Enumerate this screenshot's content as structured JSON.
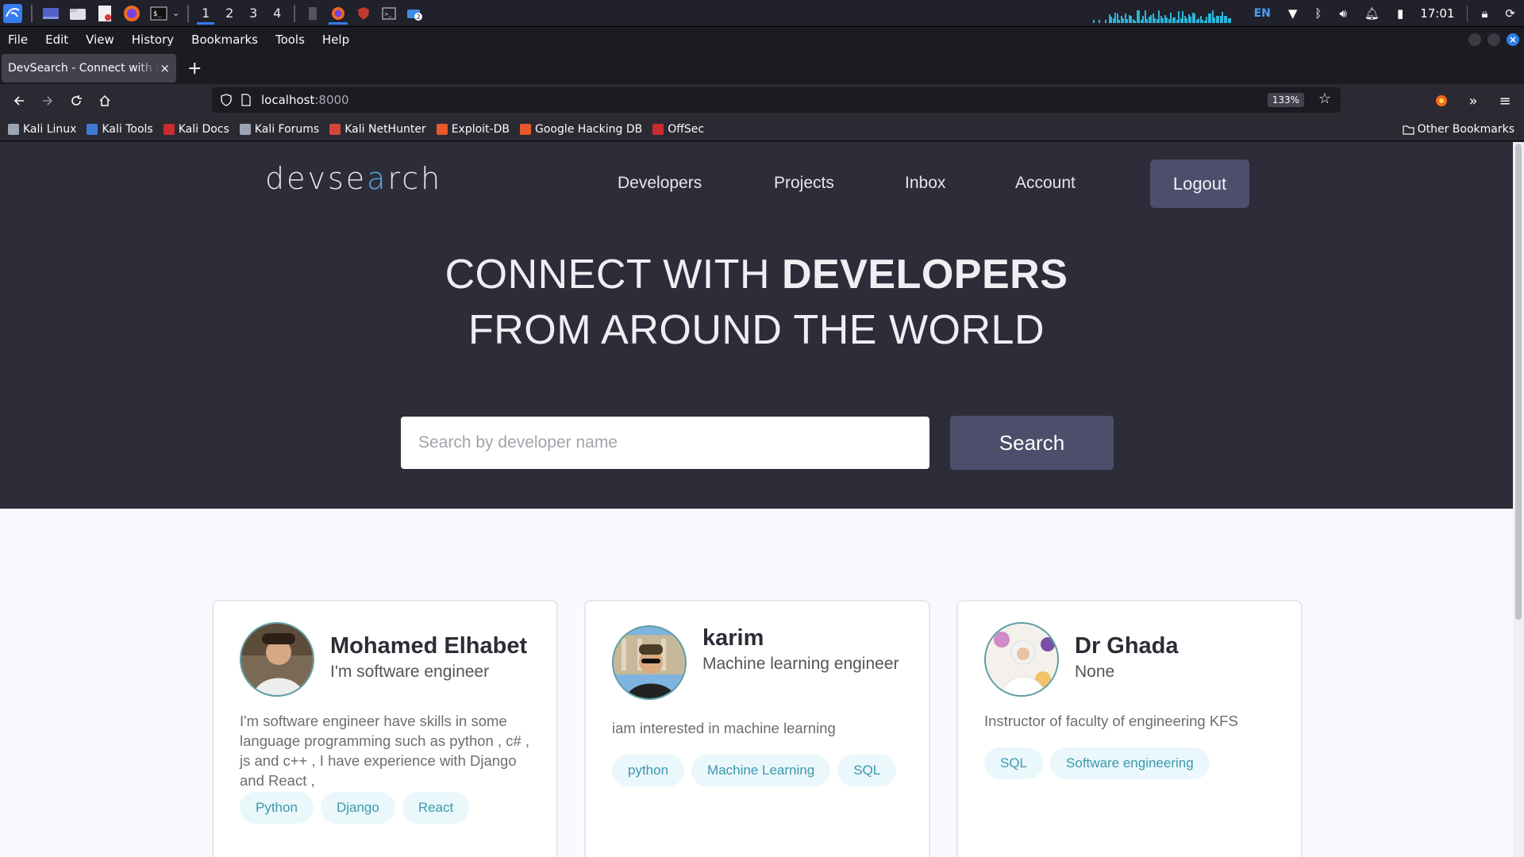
{
  "os_panel": {
    "workspaces": [
      "1",
      "2",
      "3",
      "4"
    ],
    "active_workspace": "1",
    "language": "EN",
    "clock": "17:01"
  },
  "browser": {
    "menu": [
      "File",
      "Edit",
      "View",
      "History",
      "Bookmarks",
      "Tools",
      "Help"
    ],
    "tab_title": "DevSearch - Connect with Developers",
    "tab_close": "×",
    "new_tab": "+",
    "url_host": "localhost",
    "url_port": ":8000",
    "zoom": "133%",
    "bookmarks": [
      {
        "label": "Kali Linux",
        "color": "#9aa4b4"
      },
      {
        "label": "Kali Tools",
        "color": "#3e7ad8"
      },
      {
        "label": "Kali Docs",
        "color": "#c92c2c"
      },
      {
        "label": "Kali Forums",
        "color": "#9aa4b4"
      },
      {
        "label": "Kali NetHunter",
        "color": "#d6453d"
      },
      {
        "label": "Exploit-DB",
        "color": "#e8582a"
      },
      {
        "label": "Google Hacking DB",
        "color": "#e8582a"
      },
      {
        "label": "OffSec",
        "color": "#c92c2c"
      }
    ],
    "other_bookmarks": "Other Bookmarks"
  },
  "site": {
    "logo_prefix": "devse",
    "logo_mark": "a",
    "logo_suffix": "rch",
    "nav": [
      "Developers",
      "Projects",
      "Inbox",
      "Account"
    ],
    "logout": "Logout",
    "hero_line1_light": "CONNECT WITH ",
    "hero_line1_bold": "DEVELOPERS",
    "hero_line2": "FROM AROUND THE WORLD",
    "search_placeholder": "Search by developer name",
    "search_button": "Search"
  },
  "developers": [
    {
      "name": "Mohamed Elhabet",
      "headline": "I'm software engineer",
      "bio": "I'm software engineer have skills in some language programming such as python , c# , js and c++ , I have experience with Django and React ,",
      "tags": [
        "Python",
        "Django",
        "React"
      ]
    },
    {
      "name": "karim",
      "headline": "Machine learning engineer",
      "bio": "iam interested in machine learning",
      "tags": [
        "python",
        "Machine Learning",
        "SQL"
      ]
    },
    {
      "name": "Dr Ghada",
      "headline": "None",
      "bio": "Instructor of faculty of engineering KFS",
      "tags": [
        "SQL",
        "Software engineering"
      ]
    }
  ]
}
